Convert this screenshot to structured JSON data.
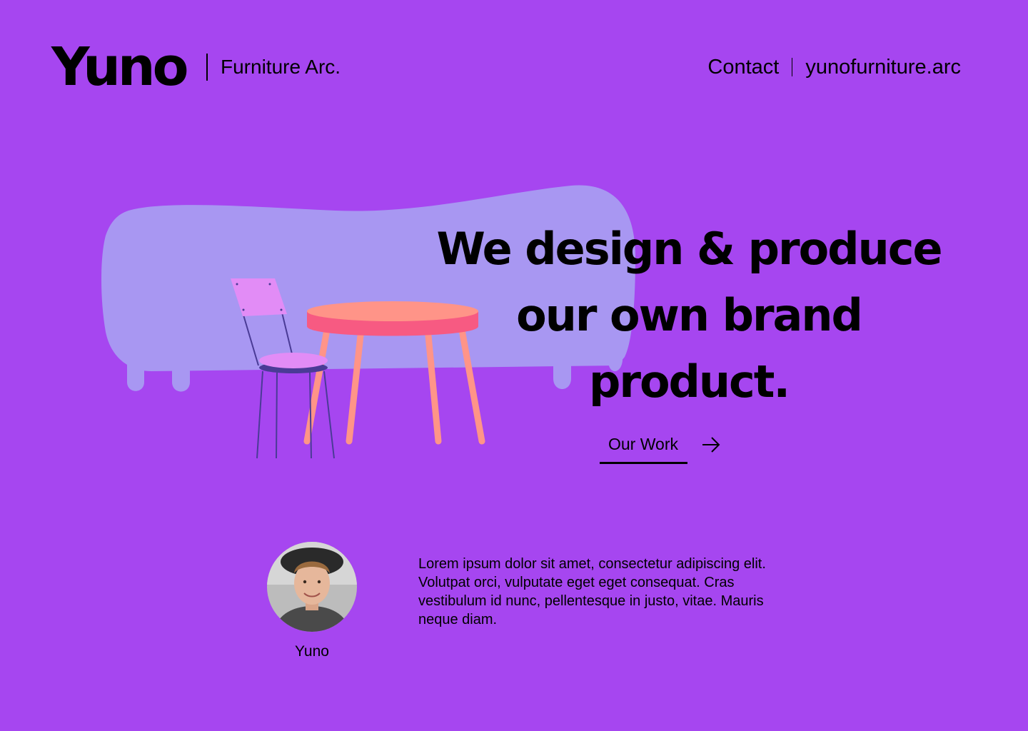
{
  "header": {
    "logo": "Yuno",
    "tagline": "Furniture Arc.",
    "nav": {
      "contact_label": "Contact",
      "website_label": "yunofurniture.arc"
    }
  },
  "hero": {
    "headline_lines": [
      "We design & produce",
      "our own brand",
      "product."
    ],
    "cta_label": "Our Work",
    "cta_icon": "arrow-right-icon",
    "illustration": "sofa-table-chair-illustration"
  },
  "profile": {
    "name": "Yuno",
    "bio": "Lorem ipsum dolor sit amet, consectetur adipiscing elit. Volutpat orci, vulputate eget eget consequat. Cras vestibulum id nunc, pellentesque in justo, vitae. Mauris neque diam."
  },
  "colors": {
    "background": "#a646f0",
    "sofa": "#a897f2",
    "table_top": "#ff9488",
    "table_rim": "#f75a82",
    "chair_seat": "#e28cf6",
    "chair_frame": "#4a3b96"
  }
}
